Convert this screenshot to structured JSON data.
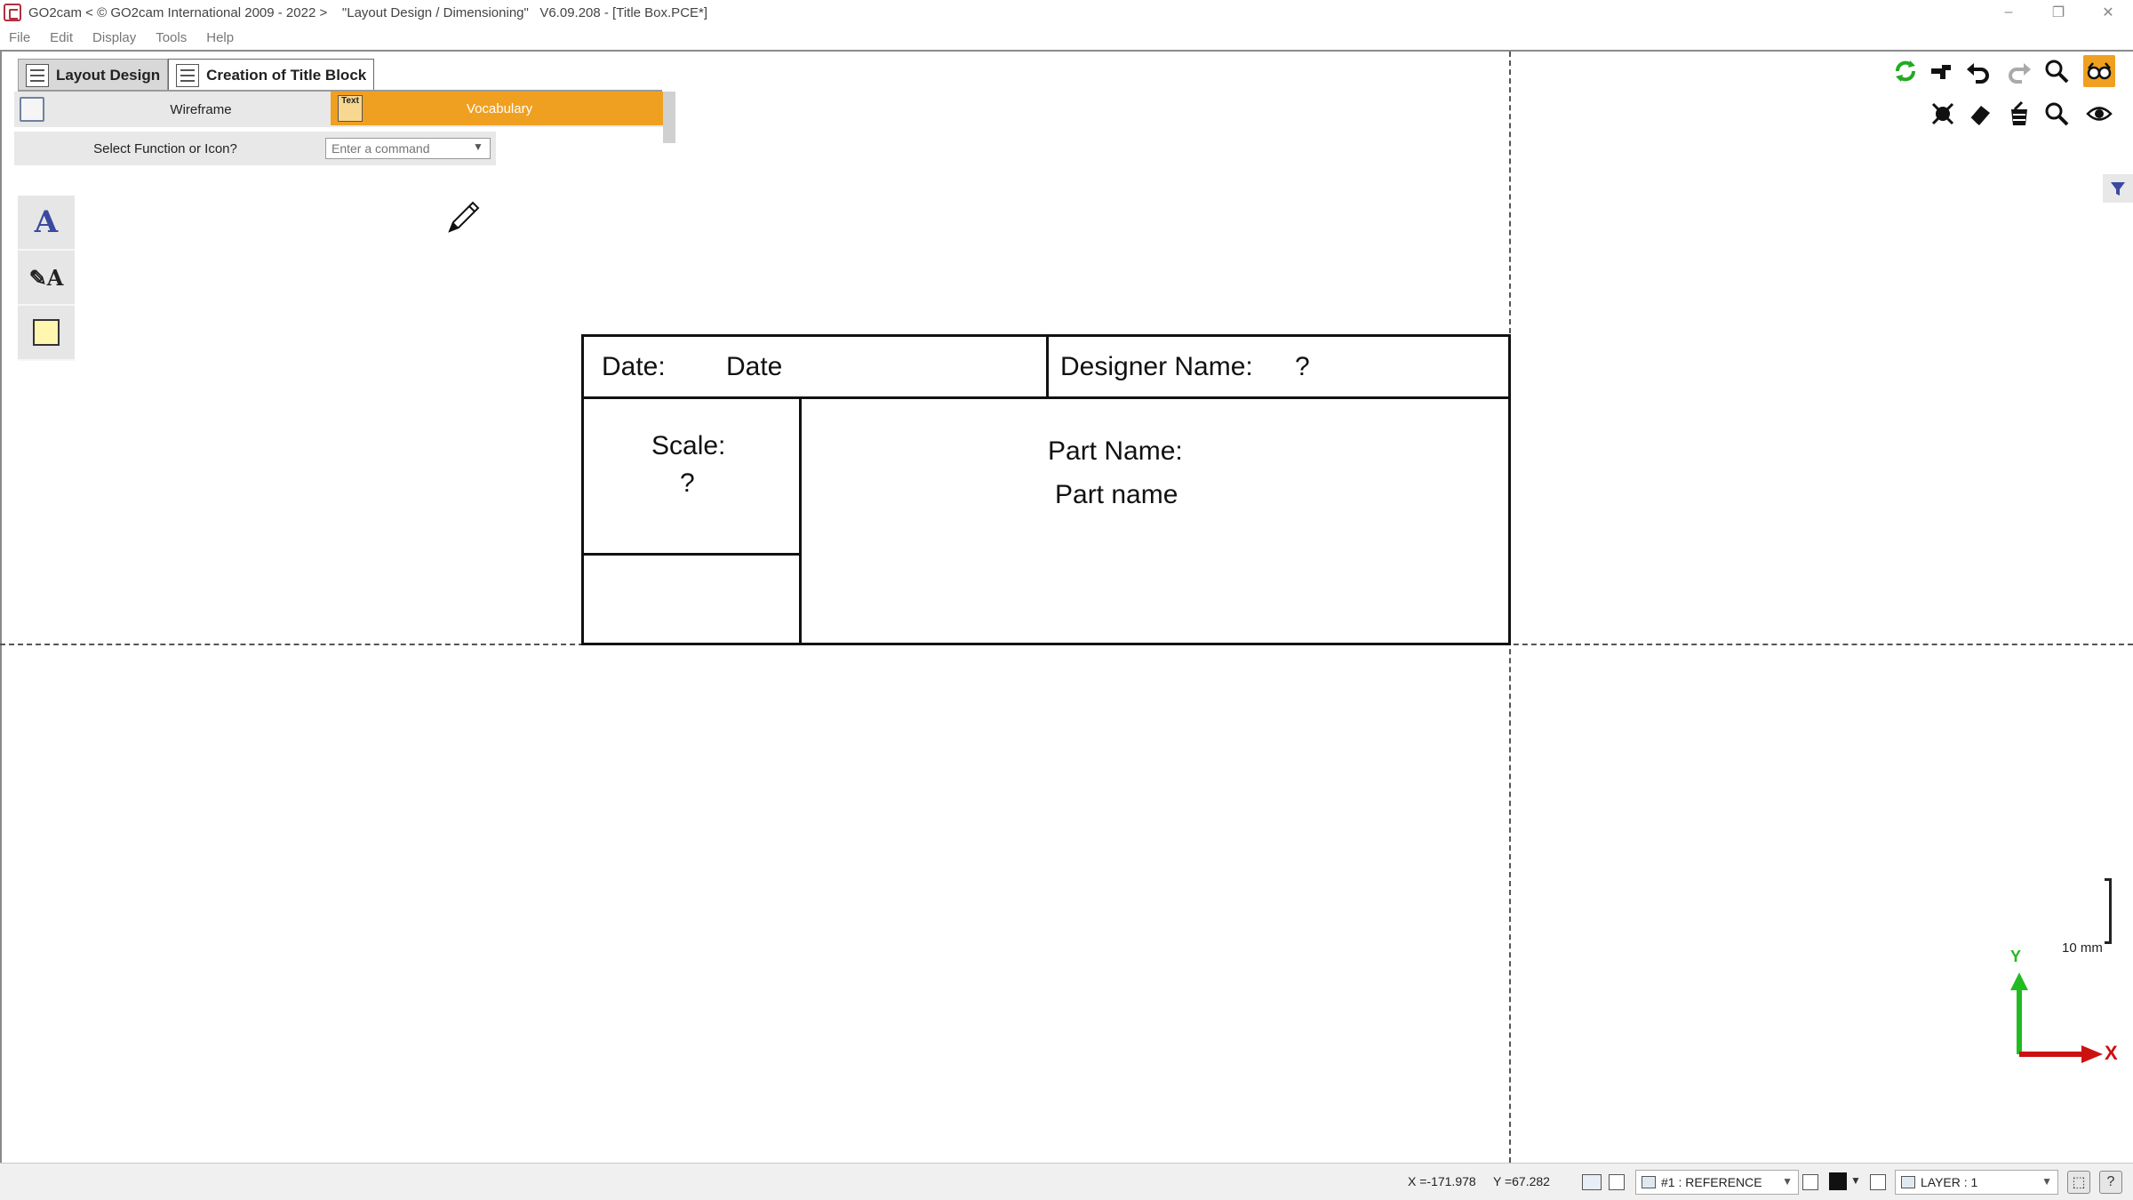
{
  "window": {
    "title": "GO2cam < © GO2cam International 2009 - 2022 >    \"Layout Design / Dimensioning\"   V6.09.208 - [Title Box.PCE*]",
    "minimize": "–",
    "restore": "❐",
    "close": "✕"
  },
  "menu": {
    "items": [
      {
        "label": "File"
      },
      {
        "label": "Edit"
      },
      {
        "label": "Display"
      },
      {
        "label": "Tools"
      },
      {
        "label": "Help"
      }
    ]
  },
  "tabs": [
    {
      "label": "Layout Design",
      "active": false
    },
    {
      "label": "Creation of Title Block",
      "active": true
    }
  ],
  "ribbon": {
    "wireframe_label": "Wireframe",
    "vocabulary_label": "Vocabulary",
    "vocab_icon_text": "Text"
  },
  "command": {
    "label": "Select Function or Icon?",
    "placeholder": "Enter a command"
  },
  "title_block": {
    "date_label": "Date:",
    "date_value": "Date",
    "designer_label": "Designer Name:",
    "designer_value": "?",
    "scale_label": "Scale:",
    "scale_value": "?",
    "part_label": "Part Name:",
    "part_value": "Part name"
  },
  "view": {
    "scale_label": "10 mm",
    "axis_x": "X",
    "axis_y": "Y"
  },
  "status": {
    "x_coord": "X =-171.978",
    "y_coord": "Y =67.282",
    "reference": "#1 : REFERENCE",
    "layer": "LAYER : 1",
    "help": "?"
  },
  "colors": {
    "accent": "#f0a020",
    "axis_x": "#cc1111",
    "axis_y": "#22bb22",
    "palette_icon": "#3a4aa0"
  }
}
